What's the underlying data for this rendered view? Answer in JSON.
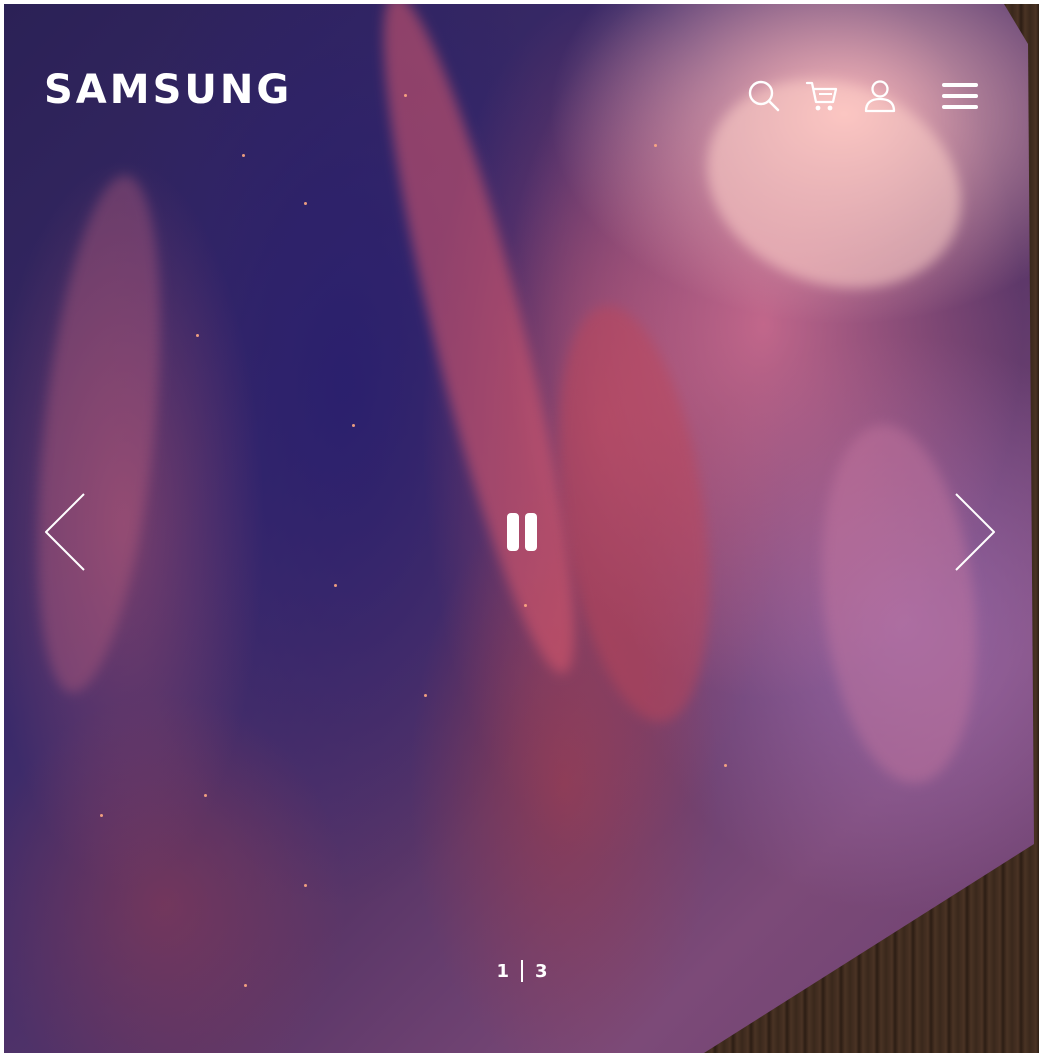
{
  "header": {
    "logo_text": "SAMSUNG",
    "icons": [
      "search-icon",
      "cart-icon",
      "user-icon",
      "menu-icon"
    ]
  },
  "carousel": {
    "prev_icon": "chevron-left-icon",
    "next_icon": "chevron-right-icon",
    "pause_icon": "pause-icon",
    "current_slide": "1",
    "total_slides": "3"
  },
  "colors": {
    "foreground": "#ffffff",
    "wall": "#3a281c"
  }
}
